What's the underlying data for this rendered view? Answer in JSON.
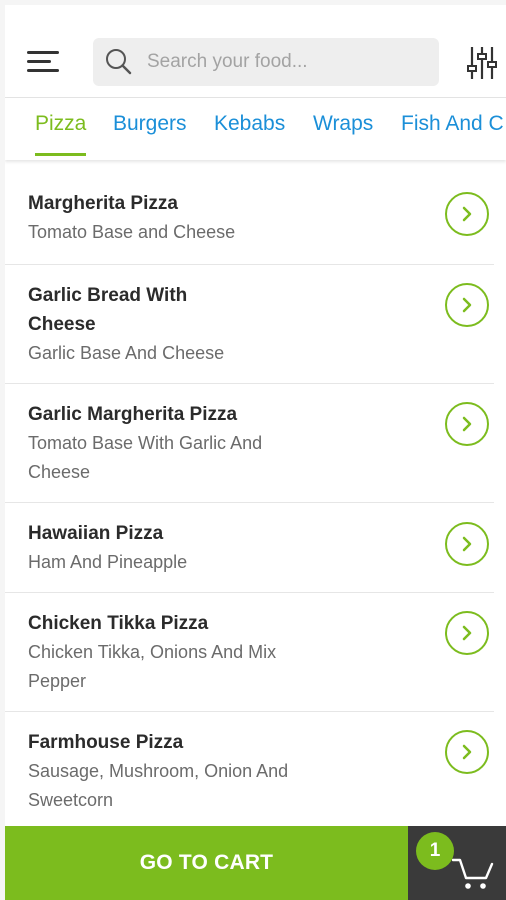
{
  "header": {
    "search_placeholder": "Search your food..."
  },
  "tabs": [
    {
      "label": "Pizza",
      "active": true
    },
    {
      "label": "Burgers",
      "active": false
    },
    {
      "label": "Kebabs",
      "active": false
    },
    {
      "label": "Wraps",
      "active": false
    },
    {
      "label": "Fish And C",
      "active": false
    }
  ],
  "items": [
    {
      "name": "Margherita Pizza",
      "description": "Tomato Base and Cheese"
    },
    {
      "name": "Garlic Bread With Cheese",
      "description": "Garlic Base And Cheese"
    },
    {
      "name": "Garlic Margherita Pizza",
      "description": "Tomato Base With Garlic And Cheese"
    },
    {
      "name": "Hawaiian Pizza",
      "description": "Ham And Pineapple"
    },
    {
      "name": "Chicken Tikka Pizza",
      "description": "Chicken Tikka, Onions And Mix Pepper"
    },
    {
      "name": "Farmhouse Pizza",
      "description": "Sausage, Mushroom, Onion And Sweetcorn"
    }
  ],
  "cart": {
    "button_label": "GO TO CART",
    "count": "1"
  },
  "icons": {
    "menu": "hamburger-menu-icon",
    "search": "search-icon",
    "filter": "sliders-icon",
    "arrow": "chevron-right-icon",
    "cart": "shopping-cart-icon"
  },
  "colors": {
    "accent_green": "#7cbc1e",
    "tab_blue": "#1b8fd8",
    "cart_dark": "#3a3a3a"
  }
}
